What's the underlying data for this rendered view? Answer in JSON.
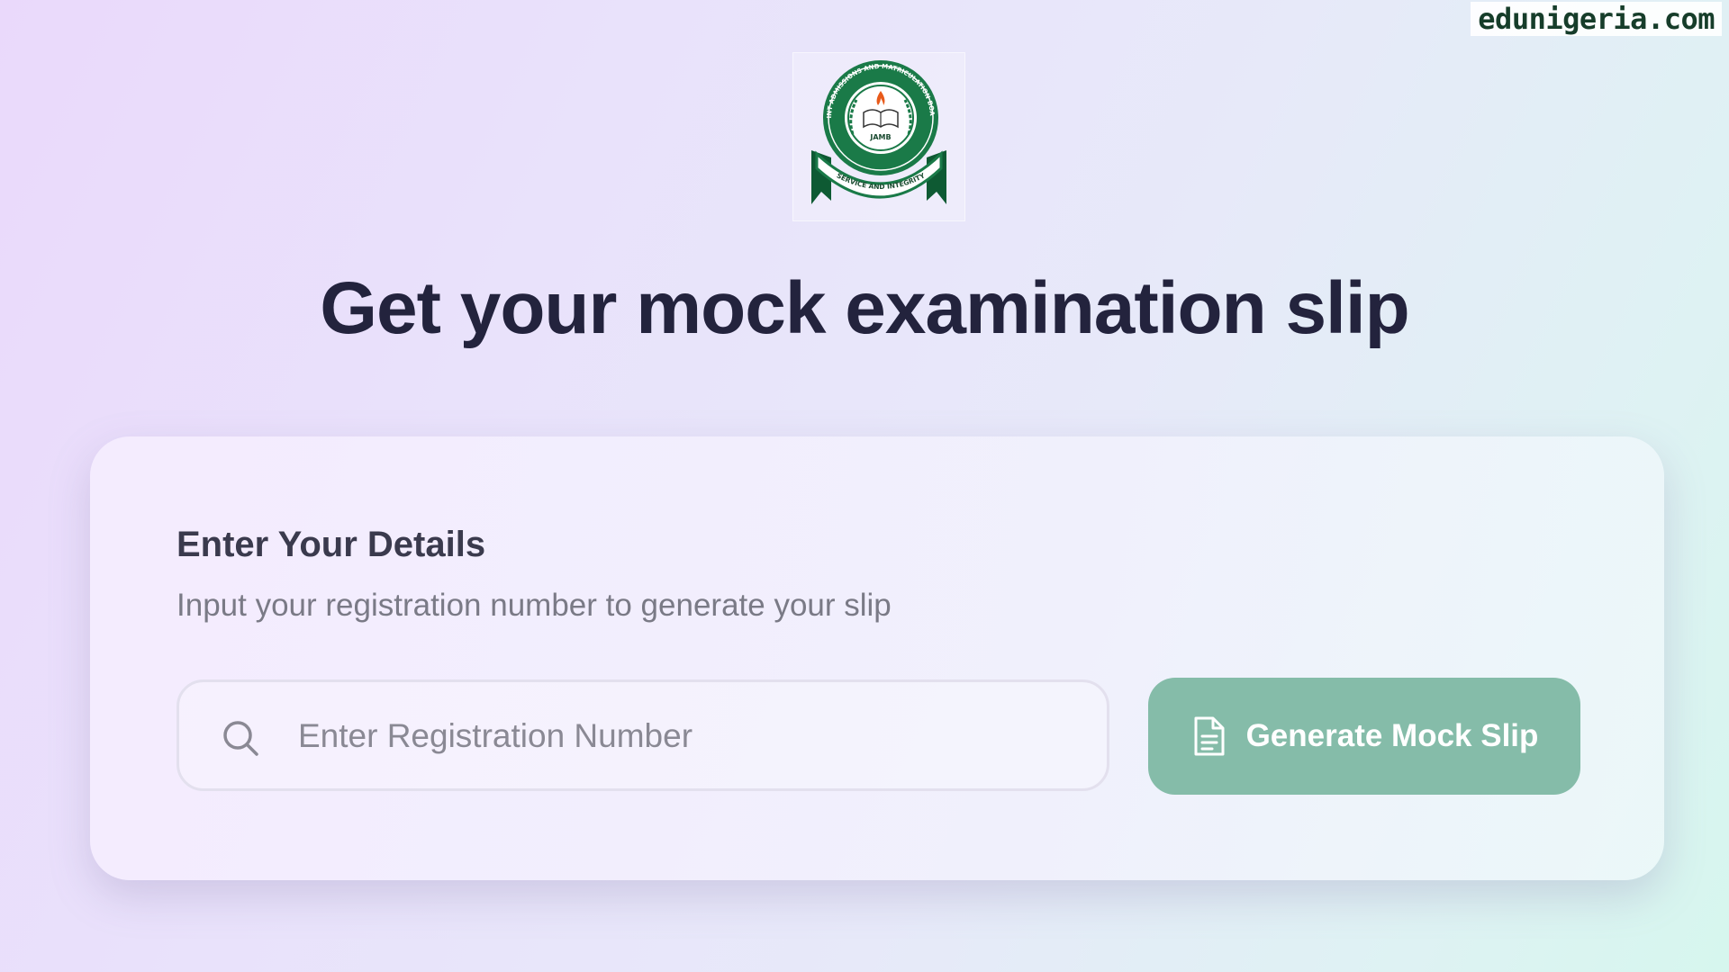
{
  "watermark": "edunigeria.com",
  "logo": {
    "ring_top": "JOINT ADMISSIONS AND MATRICULATION BOARD",
    "center_label": "JAMB",
    "ribbon": "SERVICE AND INTEGRITY",
    "colors": {
      "green": "#1a7a48",
      "dark_green": "#0e5a33",
      "flame": "#e85a1a"
    }
  },
  "page": {
    "title": "Get your mock examination slip"
  },
  "card": {
    "heading": "Enter Your Details",
    "subtitle": "Input your registration number to generate your slip",
    "reg_input": {
      "value": "",
      "placeholder": "Enter Registration Number",
      "icon": "search-icon"
    },
    "generate_button": {
      "label": "Generate Mock Slip",
      "icon": "document-icon",
      "color": "#85bca9"
    }
  }
}
